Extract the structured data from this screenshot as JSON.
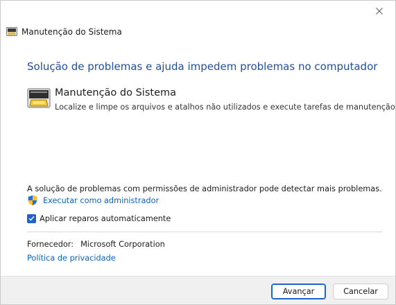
{
  "window": {
    "header_title": "Manutenção do Sistema",
    "heading": "Solução de problemas e ajuda impedem problemas no computador"
  },
  "item": {
    "title": "Manutenção do Sistema",
    "description": "Localize e limpe os arquivos e atalhos não utilizados e execute tarefas de manutenção.",
    "icon": "maintenance-icon"
  },
  "admin": {
    "note": "A solução de problemas com permissões de administrador pode detectar mais problemas.",
    "link": "Executar como administrador",
    "icon": "uac-shield-icon"
  },
  "auto_repair": {
    "label": "Aplicar reparos automaticamente",
    "checked": true
  },
  "vendor": {
    "label": "Fornecedor:",
    "value": "Microsoft Corporation"
  },
  "privacy_link": "Política de privacidade",
  "buttons": {
    "next": "Avançar",
    "cancel": "Cancelar"
  },
  "colors": {
    "heading": "#1f4f9e",
    "link": "#0b62c4",
    "accent": "#1f62c8",
    "footer": "#f0f0f0"
  }
}
